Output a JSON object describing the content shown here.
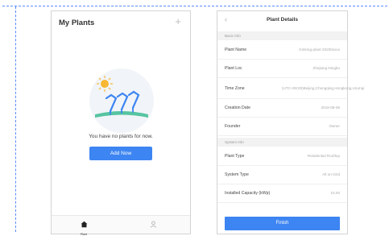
{
  "screen1": {
    "title": "My Plants",
    "add_icon": "plus-icon",
    "empty_message": "You have no plants for now.",
    "add_button": "Add Now",
    "tabs": [
      {
        "icon": "home-icon",
        "label": "Plant"
      },
      {
        "icon": "user-icon",
        "label": ""
      }
    ]
  },
  "screen2": {
    "back_icon": "chevron-left-icon",
    "title": "Plant Details",
    "sections": [
      {
        "title": "Basic Info",
        "rows": [
          {
            "label": "Plant Name",
            "value": "Ginlong-plant-20200xxxx"
          },
          {
            "label": "Plant Loc",
            "value": "Zhejiang Ningbo"
          },
          {
            "label": "Time Zone",
            "value": "(UTC+08:00)Beijing,Chongqing,Hongkong,Urumqi"
          },
          {
            "label": "Creation Date",
            "value": "2019-08-06"
          },
          {
            "label": "Founder",
            "value": "Owner"
          }
        ]
      },
      {
        "title": "System Info",
        "rows": [
          {
            "label": "Plant Type",
            "value": "Residential Rooftop"
          },
          {
            "label": "System Type",
            "value": "All on-Grid"
          },
          {
            "label": "Installed Capacity (kWp)",
            "value": "10.00"
          }
        ]
      }
    ],
    "finish_button": "Finish"
  },
  "colors": {
    "accent": "#3d85f2",
    "guide": "#5b8cff",
    "sun": "#f7b733",
    "panel": "#3d85f2"
  }
}
